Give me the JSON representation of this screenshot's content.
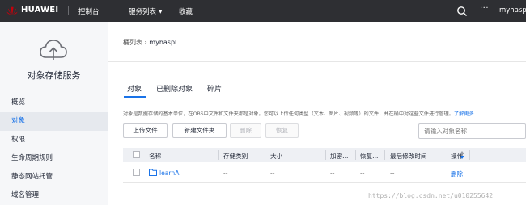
{
  "topbar": {
    "brand": "HUAWEI",
    "nav": [
      "控制台",
      "服务列表",
      "收藏"
    ],
    "more": "···",
    "user": "myhaspl",
    "colors": {
      "bg": "#2e2f33",
      "logo": "#c7000b"
    }
  },
  "sidebar": {
    "service_name": "对象存储服务",
    "icon": "cloud-upload-icon",
    "items": [
      {
        "label": "概览",
        "active": false
      },
      {
        "label": "对象",
        "active": true
      },
      {
        "label": "权限",
        "active": false
      },
      {
        "label": "生命周期规则",
        "active": false
      },
      {
        "label": "静态网站托管",
        "active": false
      },
      {
        "label": "域名管理",
        "active": false
      }
    ]
  },
  "breadcrumb": {
    "parent": "桶列表",
    "sep": "›",
    "current": "myhaspl"
  },
  "tabs": [
    {
      "label": "对象",
      "active": true
    },
    {
      "label": "已删除对象",
      "active": false
    },
    {
      "label": "碎片",
      "active": false
    }
  ],
  "description": {
    "text": "对象是数据存储的基本单位，在OBS中文件和文件夹都是对象。您可以上传任何类型（文本、图片、视频等）的文件，并在桶中对这些文件进行管理。",
    "link": "了解更多"
  },
  "toolbar": {
    "upload": "上传文件",
    "new_folder": "新建文件夹",
    "delete": "删除",
    "restore": "恢复",
    "search_placeholder": "请输入对象名称"
  },
  "table": {
    "columns": [
      "名称",
      "存储类别",
      "大小",
      "加密...",
      "恢复...",
      "最后修改时间",
      "操作"
    ],
    "rows": [
      {
        "name": "learnAi",
        "storage_class": "--",
        "size": "--",
        "encryption": "--",
        "restore": "--",
        "modified": "--",
        "action": "删除"
      }
    ]
  },
  "watermark": "https://blog.csdn.net/u010255642",
  "accent": "#1a73e8"
}
